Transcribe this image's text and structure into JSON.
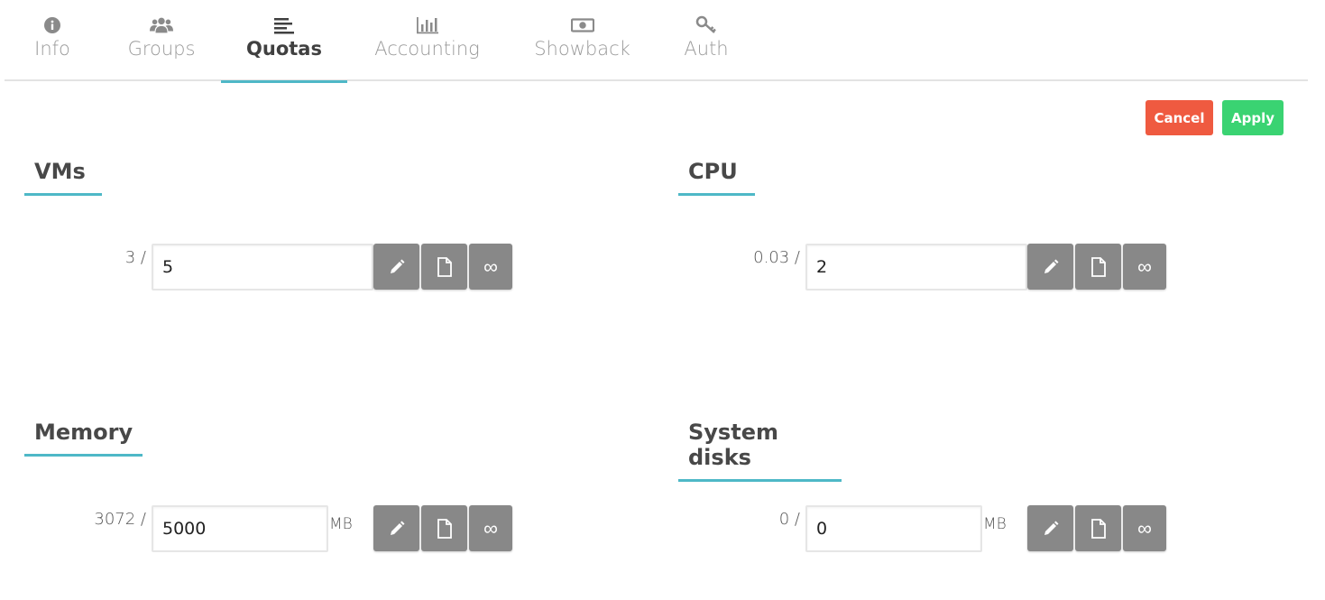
{
  "tabs": [
    {
      "label": "Info",
      "icon": "info-circle-icon",
      "active": false
    },
    {
      "label": "Groups",
      "icon": "users-icon",
      "active": false
    },
    {
      "label": "Quotas",
      "icon": "align-left-icon",
      "active": true
    },
    {
      "label": "Accounting",
      "icon": "bar-chart-icon",
      "active": false
    },
    {
      "label": "Showback",
      "icon": "money-icon",
      "active": false
    },
    {
      "label": "Auth",
      "icon": "key-icon",
      "active": false
    }
  ],
  "actions": {
    "cancel_label": "Cancel",
    "apply_label": "Apply"
  },
  "colors": {
    "accent": "#4eb8c7",
    "cancel": "#ef5a40",
    "apply": "#3ad372",
    "icon_button": "#888888"
  },
  "quotas": {
    "vms": {
      "title": "VMs",
      "used": "3 /",
      "value": "5",
      "unit": ""
    },
    "cpu": {
      "title": "CPU",
      "used": "0.03 /",
      "value": "2",
      "unit": ""
    },
    "memory": {
      "title": "Memory",
      "used": "3072 /",
      "value": "5000",
      "unit": "MB"
    },
    "system_disks": {
      "title": "System disks",
      "used": "0 /",
      "value": "0",
      "unit": "MB"
    }
  },
  "button_glyphs": {
    "infinite": "∞"
  }
}
